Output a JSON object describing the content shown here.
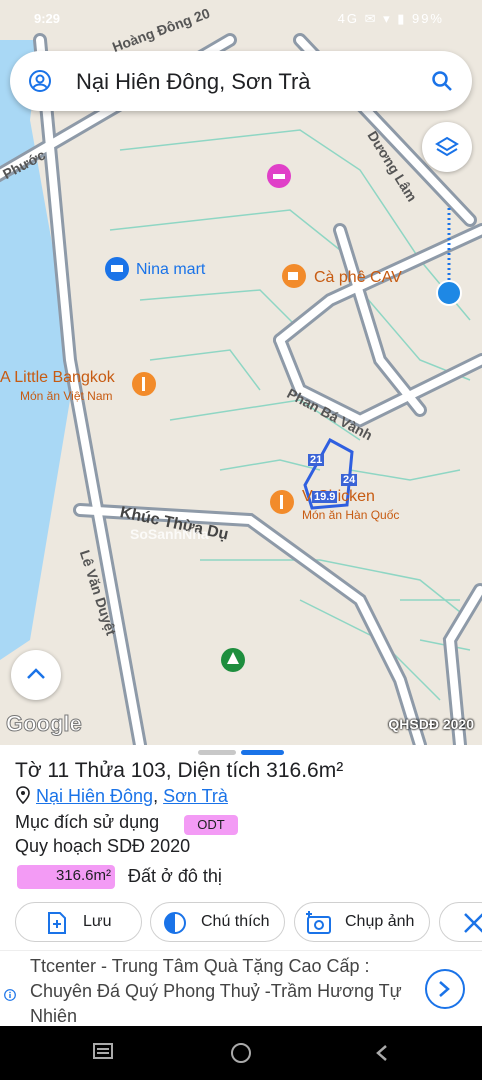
{
  "status": {
    "time": "9:29",
    "icons": "4G ✉ ▾ ▮ 99%"
  },
  "search": {
    "query": "Nại Hiên Đông, Sơn Trà"
  },
  "map": {
    "streets": [
      "Phước",
      "Hoàng Đông 20",
      "Phan Bá Vành",
      "Khúc Thừa Dụ",
      "Lê Văn Duyệt",
      "Dương Lâm"
    ],
    "pois": [
      {
        "name": "Nina mart",
        "icon": "shopping-cart-icon"
      },
      {
        "name": "Cà phê CAV",
        "icon": "coffee-icon"
      },
      {
        "name": "A Little Bangkok",
        "sub": "Món ăn Việt Nam",
        "icon": "restaurant-icon"
      },
      {
        "name": "V Chicken",
        "sub": "Món ăn Hàn Quốc",
        "icon": "restaurant-icon"
      }
    ],
    "parcel_labels": [
      "21",
      "24",
      "19.9"
    ],
    "watermark": "SoSanhNha",
    "logo": "Google",
    "layer_label": "QHSDĐ 2020"
  },
  "sheet": {
    "title": "Tờ 11 Thửa 103, Diện tích 316.6m²",
    "ward": "Nại Hiên Đông",
    "separator": ",",
    "district": "Sơn Trà",
    "purpose_label": "Mục đích sử dụng",
    "purpose_code": "ODT",
    "plan_label": "Quy hoạch SDĐ 2020",
    "area_value": "316.6m²",
    "area_fill_fraction": 1.0,
    "area_desc": "Đất ở đô thị",
    "actions": [
      {
        "label": "Lưu",
        "icon": "add-file-icon"
      },
      {
        "label": "Chú thích",
        "icon": "contrast-icon"
      },
      {
        "label": "Chụp ảnh",
        "icon": "add-photo-icon"
      },
      {
        "label": "",
        "icon": "tools-icon"
      }
    ]
  },
  "ad": {
    "text": "Ttcenter - Trung Tâm Quà Tặng Cao Cấp : Chuyên Đá Quý Phong Thuỷ -Trầm Hương Tự Nhiên"
  },
  "colors": {
    "accent": "#1a73e8",
    "badge": "#f39bf5",
    "parcel": "#3a63d6",
    "poi": "#c75b12"
  }
}
